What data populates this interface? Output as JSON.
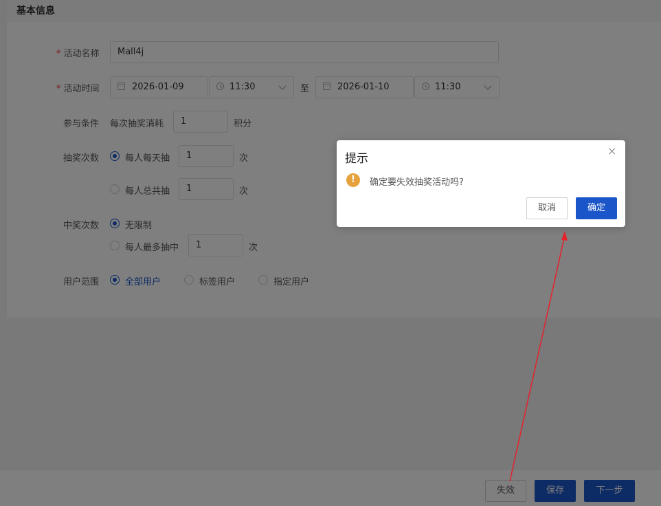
{
  "section": {
    "title": "基本信息"
  },
  "form": {
    "name": {
      "label": "活动名称",
      "value": "Mall4j"
    },
    "time": {
      "label": "活动时间",
      "start_date": "2026-01-09",
      "start_time": "11:30",
      "separator": "至",
      "end_date": "2026-01-10",
      "end_time": "11:30"
    },
    "condition": {
      "label": "参与条件",
      "prefix": "每次抽奖消耗",
      "value": "1",
      "unit": "积分"
    },
    "draw_times": {
      "label": "抽奖次数",
      "options": [
        {
          "label": "每人每天抽",
          "value": "1",
          "unit": "次",
          "selected": true
        },
        {
          "label": "每人总共抽",
          "value": "1",
          "unit": "次",
          "selected": false
        }
      ]
    },
    "win_times": {
      "label": "中奖次数",
      "options": [
        {
          "label": "无限制",
          "selected": true
        },
        {
          "label": "每人最多抽中",
          "value": "1",
          "unit": "次",
          "selected": false
        }
      ]
    },
    "user_scope": {
      "label": "用户范围",
      "options": [
        {
          "label": "全部用户",
          "selected": true
        },
        {
          "label": "标签用户",
          "selected": false
        },
        {
          "label": "指定用户",
          "selected": false
        }
      ]
    }
  },
  "footer": {
    "invalidate": "失效",
    "save": "保存",
    "next": "下一步"
  },
  "dialog": {
    "title": "提示",
    "message": "确定要失效抽奖活动吗?",
    "warn_glyph": "!",
    "close_glyph": "×",
    "cancel": "取消",
    "confirm": "确定"
  },
  "colors": {
    "primary": "#1a56c9",
    "warning": "#e6a23c",
    "annotation": "#e8202a"
  }
}
